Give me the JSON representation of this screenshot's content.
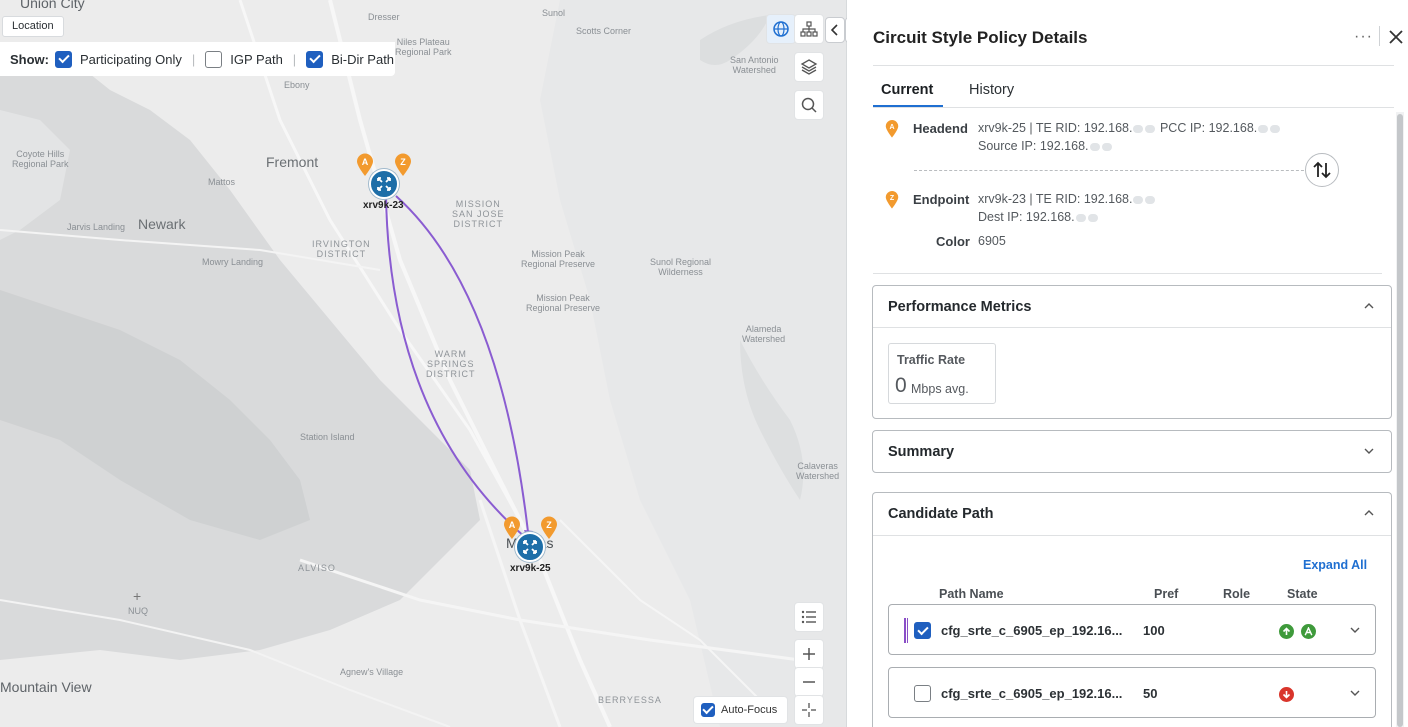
{
  "map": {
    "location_chip": "Location",
    "show": {
      "label": "Show:",
      "options": [
        {
          "label": "Participating Only",
          "checked": true
        },
        {
          "label": "IGP Path",
          "checked": false
        },
        {
          "label": "Bi-Dir Path",
          "checked": true
        }
      ]
    },
    "labels": {
      "union_city": "Union City",
      "fremont": "Fremont",
      "newark": "Newark",
      "mattos": "Mattos",
      "mowry": "Mowry Landing",
      "jarvis": "Jarvis Landing",
      "irvington": "IRVINGTON\nDISTRICT",
      "mission_san_jose": "MISSION\nSAN JOSE\nDISTRICT",
      "mission_peak_rp": "Mission Peak\nRegional Preserve",
      "mission_peak_rp2": "Mission Peak\nRegional Preserve",
      "sunol": "Sunol Regional\nWilderness",
      "sunol_town": "Sunol",
      "scotts": "Scotts Corner",
      "dresser": "Dresser",
      "plateau": "Niles Plateau\nRegional Park",
      "ebony": "Ebony",
      "coyote": "Coyote Hills\nRegional Park",
      "alameda_w": "Alameda\nWatershed",
      "san_antonio": "San Antonio\nWatershed",
      "warm_springs": "WARM\nSPRINGS\nDISTRICT",
      "station_island": "Station Island",
      "calaveras": "Calaveras\nWatershed",
      "alviso": "ALVISO",
      "nuq": "NUQ",
      "mountain_view": "Mountain View",
      "agnews": "Agnew's Village",
      "berryessa": "BERRYESSA",
      "milpitas": "Milpitas"
    },
    "nodes": [
      {
        "name": "xrv9k-23"
      },
      {
        "name": "xrv9k-25"
      }
    ],
    "pins": {
      "a": "A",
      "z": "Z"
    },
    "auto_focus": {
      "label": "Auto-Focus",
      "checked": true
    },
    "path_color": "#8a5cd1"
  },
  "panel": {
    "title": "Circuit Style Policy Details",
    "more": "···",
    "tabs": [
      {
        "label": "Current",
        "active": true
      },
      {
        "label": "History",
        "active": false
      }
    ],
    "headend": {
      "label": "Headend",
      "line1": "xrv9k-25 | TE RID: 192.168.",
      "line1b": "PCC IP: 192.168.",
      "line2": "Source IP: 192.168."
    },
    "endpoint": {
      "label": "Endpoint",
      "line1": "xrv9k-23 | TE RID: 192.168.",
      "line2": "Dest IP: 192.168."
    },
    "color": {
      "label": "Color",
      "value": "6905"
    },
    "performance": {
      "title": "Performance Metrics",
      "metric_title": "Traffic Rate",
      "metric_value": "0",
      "metric_unit": "Mbps avg."
    },
    "summary": {
      "title": "Summary"
    },
    "candidate": {
      "title": "Candidate Path",
      "expand_all": "Expand All",
      "columns": {
        "path_name": "Path Name",
        "pref": "Pref",
        "role": "Role",
        "state": "State"
      },
      "rows": [
        {
          "name": "cfg_srte_c_6905_ep_192.16...",
          "pref": "100",
          "checked": true,
          "state": "up-active"
        },
        {
          "name": "cfg_srte_c_6905_ep_192.16...",
          "pref": "50",
          "checked": false,
          "state": "down"
        }
      ]
    },
    "colors": {
      "accent": "#1f6fd1",
      "pin": "#f29a2e",
      "node": "#1d6ea8",
      "up": "#3f9a3b",
      "down": "#d9352b"
    }
  }
}
